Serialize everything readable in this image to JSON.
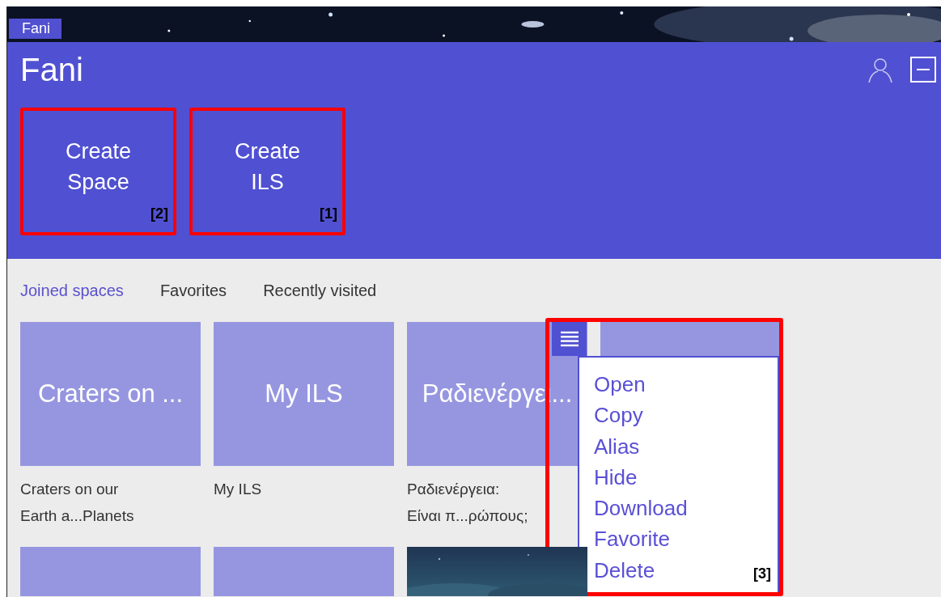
{
  "banner": {
    "tab": "Fani",
    "kind": "picture"
  },
  "header": {
    "title": "Fani",
    "actions": [
      {
        "lines": [
          "Create",
          "Space"
        ],
        "annotation": "[2]"
      },
      {
        "lines": [
          "Create",
          "ILS"
        ],
        "annotation": "[1]"
      }
    ]
  },
  "tabs": [
    {
      "label": "Joined spaces",
      "selected": true
    },
    {
      "label": "Favorites",
      "selected": false
    },
    {
      "label": "Recently visited",
      "selected": false
    }
  ],
  "tiles": [
    {
      "kind": "tile",
      "title": "Craters on ...",
      "caption": [
        "Craters on our",
        "Earth a...Planets"
      ]
    },
    {
      "kind": "tile",
      "title": "My ILS",
      "caption": [
        "My ILS"
      ]
    },
    {
      "kind": "tile",
      "title": "Ραδιενέργει...",
      "caption": [
        "Ραδιενέργεια:",
        "Είναι π...ρώπους;"
      ]
    },
    {
      "kind": "menu-tile",
      "menu": {
        "annotation": "[3]",
        "items": [
          "Open",
          "Copy",
          "Alias",
          "Hide",
          "Download",
          "Favorite",
          "Delete"
        ]
      }
    },
    {
      "kind": "blank"
    },
    {
      "kind": "blank"
    },
    {
      "kind": "picture"
    }
  ]
}
